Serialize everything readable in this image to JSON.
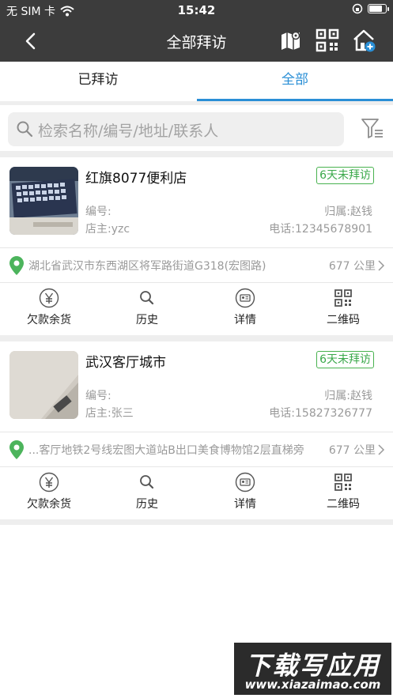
{
  "status_bar": {
    "carrier": "无 SIM 卡",
    "time": "15:42"
  },
  "nav": {
    "title": "全部拜访",
    "icons": [
      "map-icon",
      "qr-code-icon",
      "add-store-icon"
    ]
  },
  "tabs": [
    {
      "label": "已拜访",
      "active": false
    },
    {
      "label": "全部",
      "active": true
    }
  ],
  "search": {
    "placeholder": "检索名称/编号/地址/联系人"
  },
  "colors": {
    "header_bg": "#3c3c3c",
    "accent": "#2a8fd6",
    "badge_green": "#3aa84a"
  },
  "stores": [
    {
      "name": "红旗8077便利店",
      "badge": "6天未拜访",
      "code_label": "编号:",
      "owner_label": "店主:yzc",
      "belong": "归属:赵钱",
      "phone": "电话:12345678901",
      "address": "湖北省武汉市东西湖区将军路街道G318(宏图路)",
      "distance": "677 公里"
    },
    {
      "name": "武汉客厅城市",
      "badge": "6天未拜访",
      "code_label": "编号:",
      "owner_label": "店主:张三",
      "belong": "归属:赵钱",
      "phone": "电话:15827326777",
      "address": "...客厅地铁2号线宏图大道站B出口美食博物馆2层直梯旁",
      "distance": "677 公里"
    }
  ],
  "actions": [
    {
      "label": "欠款余货",
      "icon": "yen-circle-icon"
    },
    {
      "label": "历史",
      "icon": "search-icon"
    },
    {
      "label": "详情",
      "icon": "id-card-icon"
    },
    {
      "label": "二维码",
      "icon": "qr-code-icon"
    }
  ],
  "watermark": {
    "line1": "下载写应用",
    "line2": "www.xiazaimao.com"
  }
}
